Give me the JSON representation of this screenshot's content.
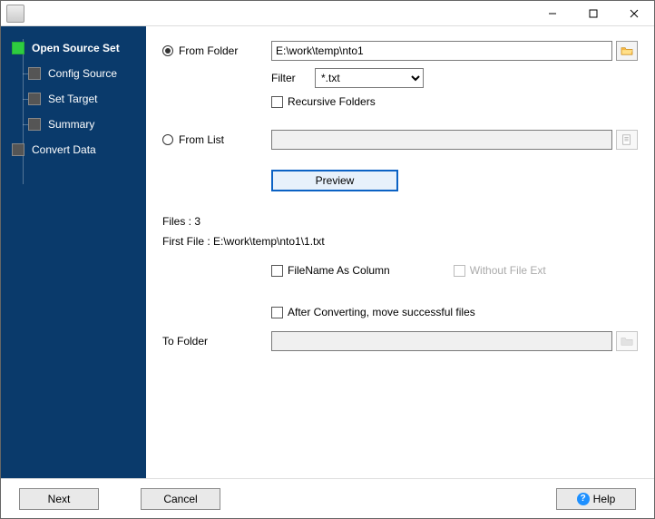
{
  "sidebar": {
    "items": [
      {
        "label": "Open Source Set"
      },
      {
        "label": "Config Source"
      },
      {
        "label": "Set Target"
      },
      {
        "label": "Summary"
      },
      {
        "label": "Convert Data"
      }
    ]
  },
  "main": {
    "from_folder_label": "From Folder",
    "from_folder_value": "E:\\work\\temp\\nto1",
    "filter_label": "Filter",
    "filter_value": "*.txt",
    "recursive_label": "Recursive Folders",
    "from_list_label": "From List",
    "from_list_value": "",
    "preview_label": "Preview",
    "files_label": "Files : 3",
    "first_file_label": "First File : E:\\work\\temp\\nto1\\1.txt",
    "filename_as_column_label": "FileName As Column",
    "without_ext_label": "Without File Ext",
    "after_convert_label": "After Converting, move successful files",
    "to_folder_label": "To Folder",
    "to_folder_value": ""
  },
  "footer": {
    "next": "Next",
    "cancel": "Cancel",
    "help": "Help"
  }
}
